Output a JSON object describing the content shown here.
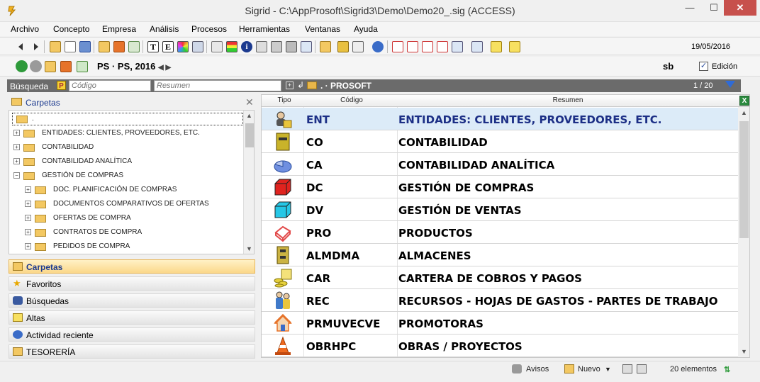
{
  "window": {
    "title": "Sigrid - C:\\AppProsoft\\Sigrid3\\Demo\\Demo20_.sig (ACCESS)",
    "min_glyph": "—",
    "max_glyph": "☐",
    "close_glyph": "✕"
  },
  "menu": [
    "Archivo",
    "Concepto",
    "Empresa",
    "Análisis",
    "Procesos",
    "Herramientas",
    "Ventanas",
    "Ayuda"
  ],
  "toolbar": {
    "date": "19/05/2016"
  },
  "nav": {
    "context": "PS · PS, 2016",
    "user": "sb",
    "edit_checked": true,
    "edit_label": "Edición"
  },
  "search": {
    "label": "Búsqueda",
    "code_placeholder": "Código",
    "summary_placeholder": "Resumen",
    "path": ". · PROSOFT",
    "page_count": "1 / 20"
  },
  "tree": {
    "header": "Carpetas",
    "root": ".",
    "items": [
      {
        "label": "ENTIDADES: CLIENTES, PROVEEDORES, ETC.",
        "level": 1
      },
      {
        "label": "CONTABILIDAD",
        "level": 1
      },
      {
        "label": "CONTABILIDAD ANALÍTICA",
        "level": 1
      },
      {
        "label": "GESTIÓN DE COMPRAS",
        "level": 1
      },
      {
        "label": "DOC. PLANIFICACIÓN DE COMPRAS",
        "level": 2
      },
      {
        "label": "DOCUMENTOS COMPARATIVOS DE OFERTAS",
        "level": 2
      },
      {
        "label": "OFERTAS DE COMPRA",
        "level": 2
      },
      {
        "label": "CONTRATOS DE COMPRA",
        "level": 2
      },
      {
        "label": "PEDIDOS DE COMPRA",
        "level": 2
      }
    ]
  },
  "accordion": [
    {
      "label": "Carpetas",
      "icon": "folder-icon",
      "active": true
    },
    {
      "label": "Favoritos",
      "icon": "star-icon",
      "active": false
    },
    {
      "label": "Búsquedas",
      "icon": "binoculars-icon",
      "active": false
    },
    {
      "label": "Altas",
      "icon": "new-record-icon",
      "active": false
    },
    {
      "label": "Actividad reciente",
      "icon": "compass-icon",
      "active": false
    },
    {
      "label": "TESORERÍA",
      "icon": "folder-icon",
      "active": false
    }
  ],
  "grid": {
    "columns": [
      "Tipo",
      "Código",
      "Resumen"
    ],
    "rows": [
      {
        "code": "ENT",
        "summary": "ENTIDADES: CLIENTES, PROVEEDORES, ETC.",
        "icon": "entity-people-icon",
        "color": "#e9c53c"
      },
      {
        "code": "CO",
        "summary": "CONTABILIDAD",
        "icon": "ledger-book-icon",
        "color": "#c9b32a"
      },
      {
        "code": "CA",
        "summary": "CONTABILIDAD ANALÍTICA",
        "icon": "pie-chart-icon",
        "color": "#6f8fe0"
      },
      {
        "code": "DC",
        "summary": "GESTIÓN DE COMPRAS",
        "icon": "red-cube-icon",
        "color": "#e0231f"
      },
      {
        "code": "DV",
        "summary": "GESTIÓN DE VENTAS",
        "icon": "cyan-cube-icon",
        "color": "#27c7e6"
      },
      {
        "code": "PRO",
        "summary": "PRODUCTOS",
        "icon": "product-box-icon",
        "color": "#e24a4a"
      },
      {
        "code": "ALMDMA",
        "summary": "ALMACENES",
        "icon": "warehouse-cabinet-icon",
        "color": "#cbb343"
      },
      {
        "code": "CAR",
        "summary": "CARTERA DE COBROS Y PAGOS",
        "icon": "coins-icon",
        "color": "#e5cf3b"
      },
      {
        "code": "REC",
        "summary": "RECURSOS - HOJAS DE GASTOS - PARTES DE TRABAJO",
        "icon": "workers-icon",
        "color": "#3f79c9"
      },
      {
        "code": "PRMUVECVE",
        "summary": "PROMOTORAS",
        "icon": "house-icon",
        "color": "#e6732a"
      },
      {
        "code": "OBRHPC",
        "summary": "OBRAS / PROYECTOS",
        "icon": "traffic-cone-icon",
        "color": "#ee6a1f"
      }
    ]
  },
  "status": {
    "avisos": "Avisos",
    "nuevo": "Nuevo",
    "count": "20 elementos"
  }
}
